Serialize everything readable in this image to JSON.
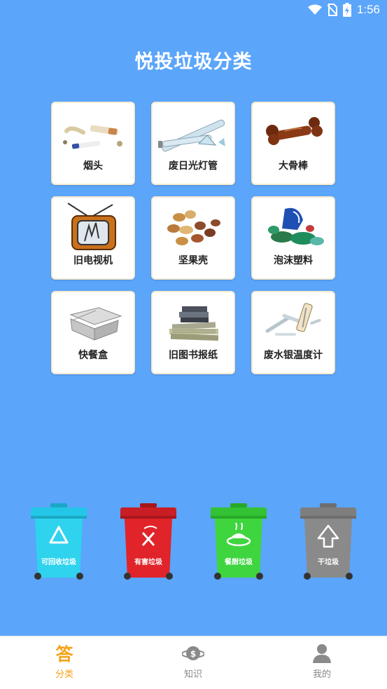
{
  "status_bar": {
    "time": "1:56",
    "icons": [
      "wifi-icon",
      "no-sim-icon",
      "battery-charging-icon"
    ]
  },
  "app": {
    "title": "悦投垃圾分类"
  },
  "items": [
    {
      "label": "烟头",
      "icon": "cigarette-butt-icon"
    },
    {
      "label": "废日光灯管",
      "icon": "fluorescent-tube-icon"
    },
    {
      "label": "大骨棒",
      "icon": "big-bone-icon"
    },
    {
      "label": "旧电视机",
      "icon": "old-tv-icon"
    },
    {
      "label": "坚果壳",
      "icon": "nut-shells-icon"
    },
    {
      "label": "泡沫塑料",
      "icon": "foam-plastic-icon"
    },
    {
      "label": "快餐盒",
      "icon": "takeout-box-icon"
    },
    {
      "label": "旧图书报纸",
      "icon": "books-newspapers-icon"
    },
    {
      "label": "废水银温度计",
      "icon": "mercury-thermometer-icon"
    }
  ],
  "bins": [
    {
      "label": "可回收垃圾",
      "color": "#2fd3ee",
      "icon": "recycle-icon"
    },
    {
      "label": "有害垃圾",
      "color": "#e0242a",
      "icon": "hazardous-icon"
    },
    {
      "label": "餐厨垃圾",
      "color": "#3fd53f",
      "icon": "kitchen-waste-icon"
    },
    {
      "label": "干垃圾",
      "color": "#8a8a8a",
      "icon": "dry-waste-icon"
    }
  ],
  "tabs": [
    {
      "label": "分类",
      "icon": "answer-icon",
      "active": true,
      "active_color": "#f5a31a"
    },
    {
      "label": "知识",
      "icon": "knowledge-planet-icon",
      "active": false
    },
    {
      "label": "我的",
      "icon": "user-icon",
      "active": false
    }
  ]
}
